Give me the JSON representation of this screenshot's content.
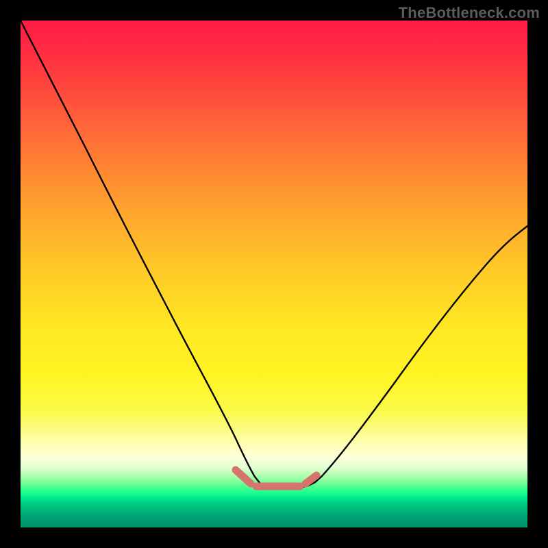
{
  "watermark": {
    "text": "TheBottleneck.com"
  },
  "chart_data": {
    "type": "line",
    "title": "",
    "xlabel": "",
    "ylabel": "",
    "xlim": [
      0,
      100
    ],
    "ylim": [
      0,
      100
    ],
    "grid": false,
    "legend": false,
    "series": [
      {
        "name": "bottleneck-curve",
        "color": "#000000",
        "x": [
          0,
          5,
          10,
          15,
          20,
          25,
          30,
          35,
          40,
          42,
          44,
          45,
          46,
          48,
          50,
          52,
          54,
          56,
          58,
          60,
          65,
          70,
          75,
          80,
          85,
          90,
          95,
          100
        ],
        "y": [
          100,
          91,
          82,
          73,
          63,
          53,
          43,
          33,
          22,
          17,
          12,
          9.5,
          8.3,
          7.7,
          7.5,
          7.5,
          7.7,
          8.2,
          9.2,
          11,
          17,
          24,
          31,
          38,
          44,
          50,
          55,
          59
        ]
      },
      {
        "name": "sweet-spot-marker",
        "color": "#d6736d",
        "segments": [
          {
            "x": [
              42.0,
              45.2
            ],
            "y": [
              11.2,
              8.6
            ]
          },
          {
            "x": [
              45.8,
              55.2
            ],
            "y": [
              8.1,
              8.1
            ]
          },
          {
            "x": [
              55.8,
              58.0
            ],
            "y": [
              8.5,
              10.2
            ]
          }
        ]
      }
    ],
    "background_gradient": {
      "top": "#ff1a47",
      "mid": "#ffe624",
      "bottom": "#008f6c"
    }
  }
}
